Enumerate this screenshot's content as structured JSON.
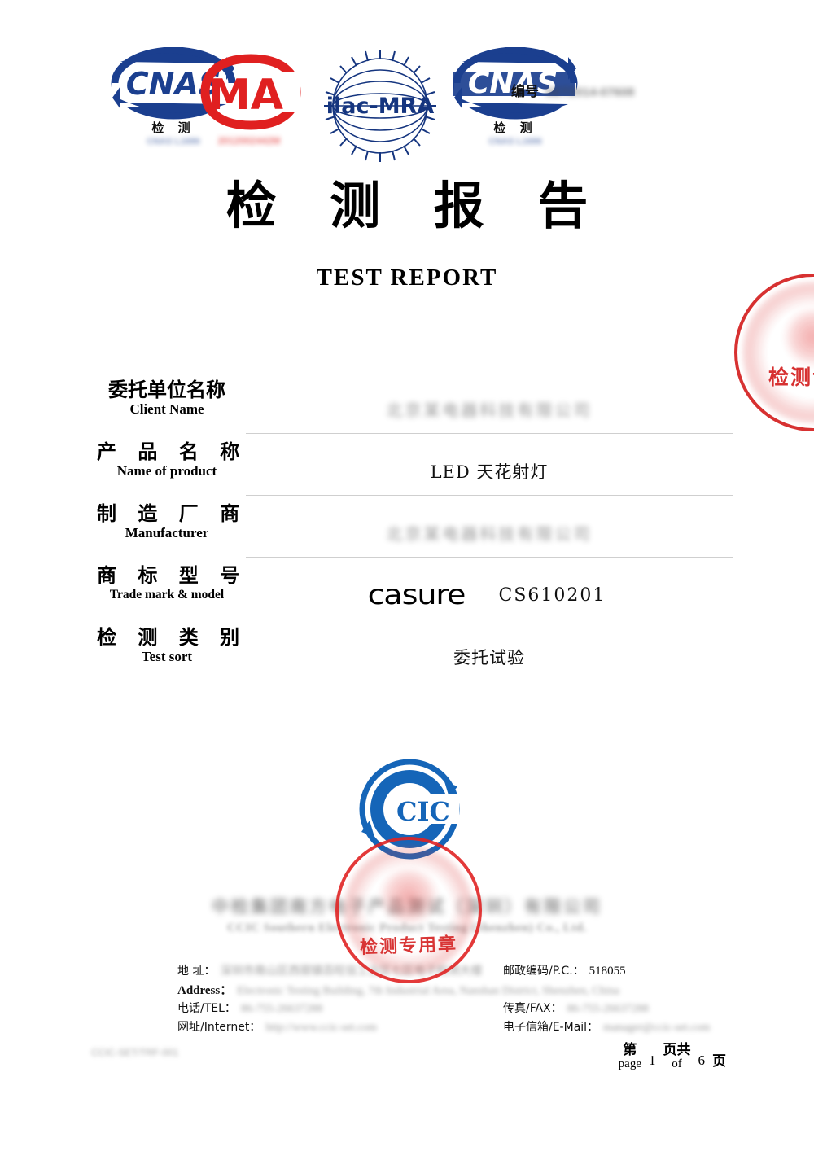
{
  "header": {
    "logos": [
      {
        "name": "cnas-logo-left",
        "wordmark": "CNAS",
        "subtitle": "检 测",
        "code": "CNAS L1686"
      },
      {
        "name": "cma-logo",
        "wordmark": "MA",
        "code": "2012002442M"
      },
      {
        "name": "ilac-mra-logo",
        "wordmark": "ilac-MRA"
      },
      {
        "name": "cnas-logo-right",
        "wordmark": "CNAS",
        "subtitle": "检 测",
        "code": "CNAS L1686"
      }
    ],
    "report_number_label": "编号",
    "report_number_value": "SET2014-07608"
  },
  "title": {
    "cn": "检 测 报 告",
    "en": "TEST   REPORT"
  },
  "form": {
    "rows": [
      {
        "label_cn": "委托单位名称",
        "label_en": "Client Name",
        "value": "北京某电器科技有限公司",
        "redacted": true
      },
      {
        "label_cn": "产 品 名 称",
        "label_en": "Name of product",
        "value": "LED 天花射灯",
        "redacted": false
      },
      {
        "label_cn": "制 造 厂 商",
        "label_en": "Manufacturer",
        "value": "北京某电器科技有限公司",
        "redacted": true
      },
      {
        "label_cn": "商 标 型 号",
        "label_en": "Trade mark & model",
        "brand": "casure",
        "model": "CS610201",
        "redacted": false
      },
      {
        "label_cn": "检 测 类 别",
        "label_en": "Test sort",
        "value": "委托试验",
        "redacted": false
      }
    ]
  },
  "cic": {
    "wordmark": "CIC"
  },
  "company": {
    "name_cn": "中检集团南方电子产品测试（深圳）有限公司",
    "name_en": "CCIC Southern Electronic Product Testing (Shenzhen) Co., Ltd."
  },
  "contact": {
    "address_label_cn": "地  址：",
    "address_label_en": "Address：",
    "address_value_cn": "深圳市南山区西丽镇百旺信工业区七区电子检测大楼",
    "address_value_en": "Electronic Testing Building, 7th Industrial Area, Nanshan District, Shenzhen, China",
    "postcode_label": "邮政编码/P.C.：",
    "postcode_value": "518055",
    "tel_label": "电话/TEL：",
    "tel_value": "86-755-26637288",
    "fax_label": "传真/FAX：",
    "fax_value": "86-755-26637288",
    "internet_label": "网址/Internet：",
    "internet_value": "http://www.ccic-set.com",
    "email_label": "电子信箱/E-Mail：",
    "email_value": "manager@ccic-set.com"
  },
  "seals": {
    "top_right": "检测专用章",
    "center": "检测专用章"
  },
  "footer": {
    "doc_code": "CCIC-SET/TRF-001",
    "page_label_cn": "第",
    "page_label_en": "page",
    "page_current": "1",
    "of_label_cn": "页共",
    "of_label_en": "of",
    "page_total": "6",
    "page_unit_cn": "页"
  },
  "colors": {
    "cnas_blue": "#1b3f8f",
    "cma_red": "#e02020",
    "ilac_blue": "#15357f",
    "cic_blue": "#1565b8",
    "seal_red": "#d42020"
  }
}
